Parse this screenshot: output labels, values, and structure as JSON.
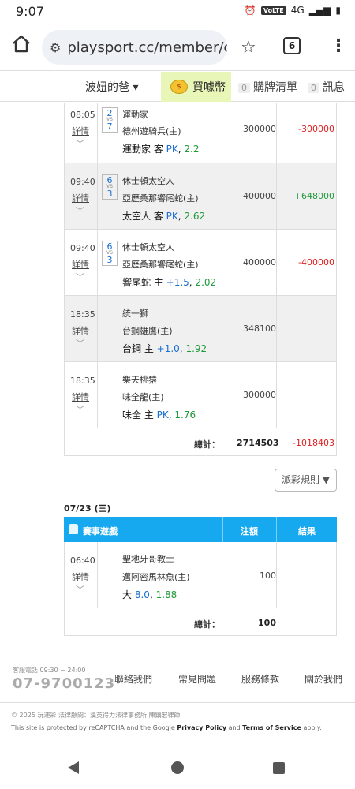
{
  "status_bar": {
    "time": "9:07",
    "network": "VoLTE",
    "signal_text": "4G"
  },
  "browser": {
    "url": "playsport.cc/member/ch",
    "tab_count": "6"
  },
  "nav": {
    "user": "波妞的爸 ▾",
    "coin": "買噱幣",
    "cart_count": "0",
    "cart": "購牌清單",
    "msg_count": "0",
    "msg": "訊息"
  },
  "section1": {
    "rows": [
      {
        "time": "08:05",
        "detail": "詳情",
        "score_a": "2",
        "score_b": "7",
        "away": "運動家",
        "home": "德州遊騎兵(主)",
        "pick_team": "運動家 客",
        "pick_handicap": "PK",
        "pick_odds": "2.2",
        "amount": "300000",
        "result": "-300000",
        "result_type": "neg"
      },
      {
        "time": "09:40",
        "detail": "詳情",
        "score_a": "6",
        "score_b": "3",
        "away": "休士頓太空人",
        "home": "亞歷桑那響尾蛇(主)",
        "pick_team": "太空人 客",
        "pick_handicap": "PK",
        "pick_odds": "2.62",
        "amount": "400000",
        "result": "+648000",
        "result_type": "pos"
      },
      {
        "time": "09:40",
        "detail": "詳情",
        "score_a": "6",
        "score_b": "3",
        "away": "休士頓太空人",
        "home": "亞歷桑那響尾蛇(主)",
        "pick_team": "響尾蛇 主",
        "pick_handicap": "+1.5",
        "pick_odds": "2.02",
        "amount": "400000",
        "result": "-400000",
        "result_type": "neg"
      },
      {
        "time": "18:35",
        "detail": "詳情",
        "score_a": "",
        "score_b": "",
        "away": "統一獅",
        "home": "台鋼雄鷹(主)",
        "pick_team": "台鋼 主",
        "pick_handicap": "+1.0",
        "pick_odds": "1.92",
        "amount": "348100",
        "result": "",
        "result_type": ""
      },
      {
        "time": "18:35",
        "detail": "詳情",
        "score_a": "",
        "score_b": "",
        "away": "樂天桃猿",
        "home": "味全龍(主)",
        "pick_team": "味全 主",
        "pick_handicap": "PK",
        "pick_odds": "1.76",
        "amount": "300000",
        "result": "",
        "result_type": ""
      }
    ],
    "total_label": "總計：",
    "total_amount": "2714503",
    "total_result": "-1018403"
  },
  "rules_button": "派彩規則 ▼",
  "section2": {
    "date": "07/23 (三)",
    "headers": {
      "game": "賽事遊戲",
      "amount": "注額",
      "result": "結果"
    },
    "rows": [
      {
        "time": "06:40",
        "detail": "詳情",
        "away": "聖地牙哥教士",
        "home": "邁阿密馬林魚(主)",
        "pick_team": "大",
        "pick_handicap": "8.0",
        "pick_odds": "1.88",
        "amount": "100",
        "result": ""
      }
    ],
    "total_label": "總計：",
    "total_amount": "100"
  },
  "footer": {
    "service_hours": "客服電話 09:30 ~ 24:00",
    "phone": "07-9700123",
    "links": [
      "聯絡我們",
      "常見問題",
      "服務條款",
      "關於我們"
    ],
    "copyright": "© 2025 玩運彩 法律顧問：漢英得力法律事務所 陳鎮宏律師",
    "recaptcha_prefix": "This site is protected by reCAPTCHA and the Google",
    "privacy": "Privacy Policy",
    "and": "and",
    "terms": "Terms of Service",
    "apply": "apply."
  },
  "colors": {
    "accent": "#17a9f0",
    "positive": "#1f9a3a",
    "negative": "#e02020",
    "coin_bg": "#e8f6b8"
  }
}
